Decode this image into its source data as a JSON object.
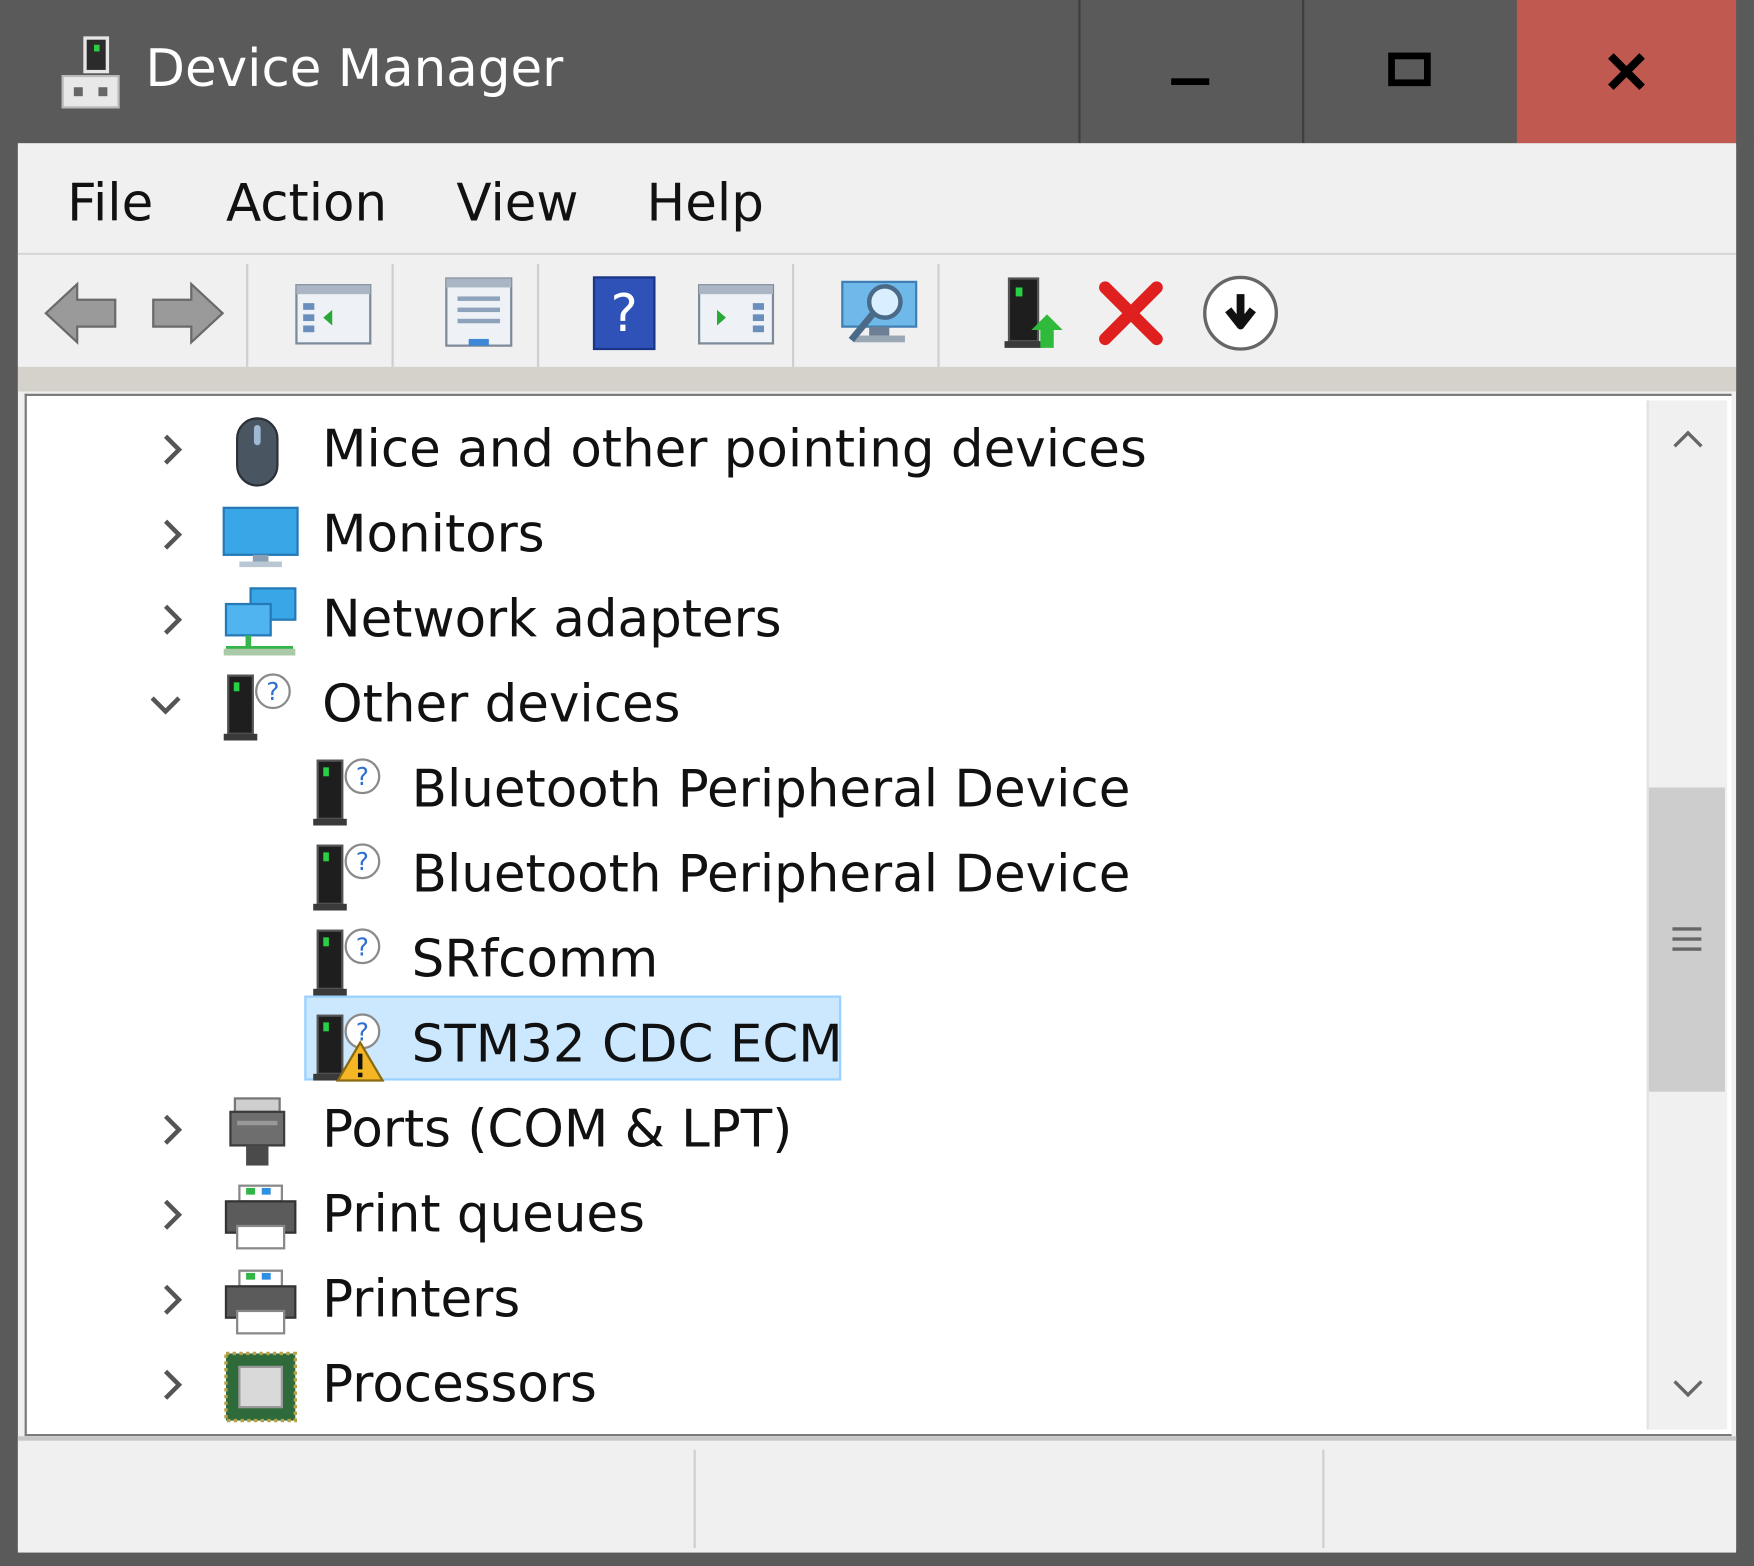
{
  "window": {
    "title": "Device Manager",
    "minimize_glyph": "—",
    "maximize_glyph": "□",
    "close_glyph": "X",
    "close_color": "#c0594f",
    "titlebar_color": "#5a5a5a"
  },
  "menu": [
    "File",
    "Action",
    "View",
    "Help"
  ],
  "toolbar": {
    "buttons": [
      {
        "icon": "back-arrow-icon"
      },
      {
        "icon": "forward-arrow-icon"
      },
      {
        "icon": "show-hide-console-tree-icon"
      },
      {
        "icon": "properties-icon"
      },
      {
        "icon": "help-icon"
      },
      {
        "icon": "show-hide-action-pane-icon"
      },
      {
        "icon": "scan-hardware-changes-icon"
      },
      {
        "icon": "update-driver-icon"
      },
      {
        "icon": "uninstall-device-icon"
      },
      {
        "icon": "disable-device-icon"
      }
    ]
  },
  "tree": {
    "items": [
      {
        "label": "Mice and other pointing devices",
        "icon": "mouse-icon",
        "expanded": false
      },
      {
        "label": "Monitors",
        "icon": "monitor-icon",
        "expanded": false
      },
      {
        "label": "Network adapters",
        "icon": "network-adapter-icon",
        "expanded": false
      },
      {
        "label": "Other devices",
        "icon": "unknown-device-icon",
        "expanded": true
      },
      {
        "label": "Bluetooth Peripheral Device",
        "icon": "unknown-device-icon",
        "child": true
      },
      {
        "label": "Bluetooth Peripheral Device",
        "icon": "unknown-device-icon",
        "child": true
      },
      {
        "label": "SRfcomm",
        "icon": "unknown-device-icon",
        "child": true
      },
      {
        "label": "STM32 CDC ECM",
        "icon": "warning-device-icon",
        "child": true,
        "selected": true
      },
      {
        "label": "Ports (COM & LPT)",
        "icon": "port-icon",
        "expanded": false
      },
      {
        "label": "Print queues",
        "icon": "printer-icon",
        "expanded": false
      },
      {
        "label": "Printers",
        "icon": "printer-icon",
        "expanded": false
      },
      {
        "label": "Processors",
        "icon": "processor-icon",
        "expanded": false
      }
    ]
  },
  "scrollbar": {
    "position": 0.42
  },
  "statusbar": {
    "fields": [
      "",
      "",
      ""
    ]
  }
}
